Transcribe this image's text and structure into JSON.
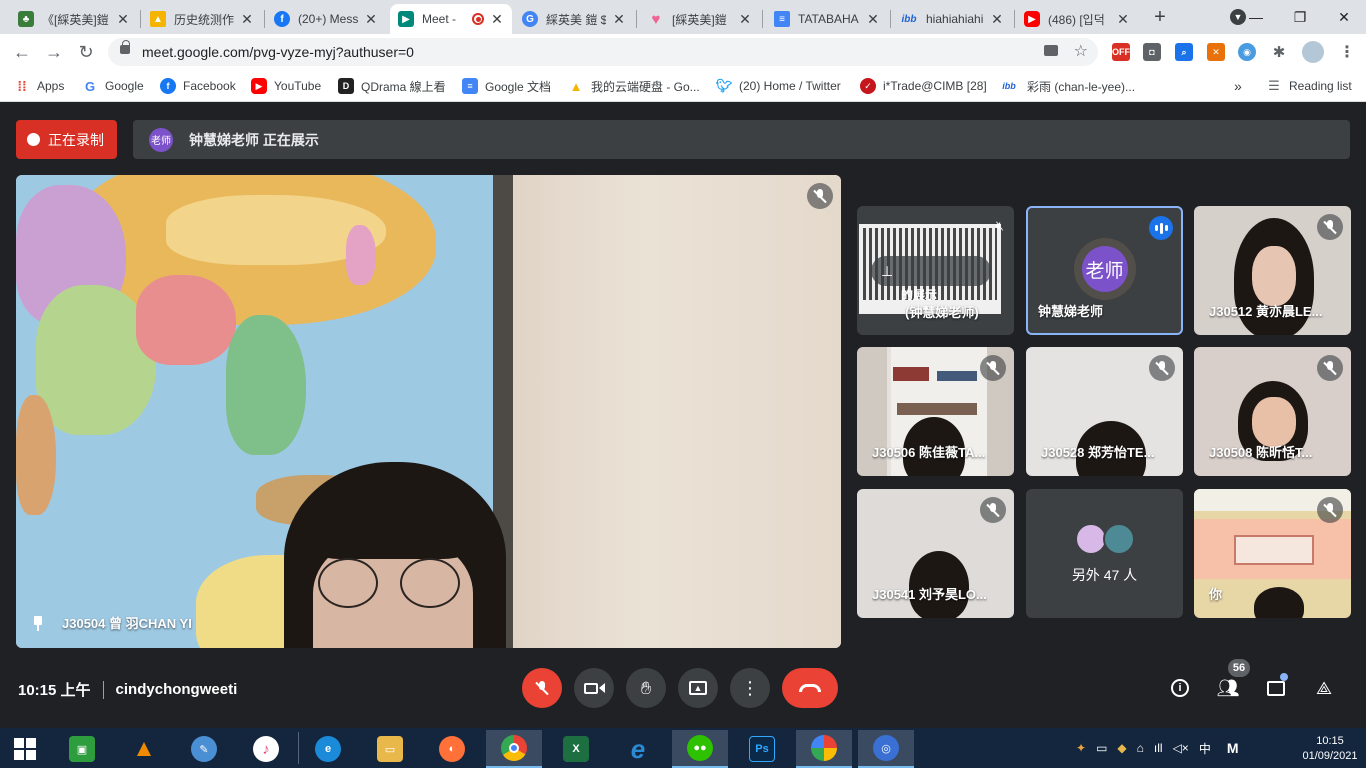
{
  "browser": {
    "tabs": [
      {
        "title": "《[綵英美]鎧",
        "favicon": "tree-icon",
        "color": "#3a7d3a",
        "active": false
      },
      {
        "title": "历史统测作",
        "favicon": "drive-icon",
        "color": "#f4b400",
        "active": false
      },
      {
        "title": "(20+) Mess",
        "favicon": "facebook-icon",
        "color": "#1877f2",
        "active": false
      },
      {
        "title": "Meet -",
        "favicon": "meet-icon",
        "color": "#00897b",
        "active": true
      },
      {
        "title": "綵英美 鎧 $",
        "favicon": "google-icon",
        "color": "#4285f4",
        "active": false
      },
      {
        "title": "[綵英美]鎧",
        "favicon": "heart-icon",
        "color": "#f06292",
        "active": false
      },
      {
        "title": "TATABAHA",
        "favicon": "docs-icon",
        "color": "#4285f4",
        "active": false
      },
      {
        "title": "hiahiahiahi",
        "favicon": "ibb-icon",
        "color": "#1e63d6",
        "active": false
      },
      {
        "title": "(486) [입덕",
        "favicon": "youtube-icon",
        "color": "#ff0000",
        "active": false
      }
    ],
    "url": "meet.google.com/pvg-vyze-myj?authuser=0",
    "bookmarks": [
      {
        "label": "Apps",
        "icon": "apps-grid-icon",
        "color": "#ea4335"
      },
      {
        "label": "Google",
        "icon": "google-icon",
        "color": "#4285f4"
      },
      {
        "label": "Facebook",
        "icon": "facebook-icon",
        "color": "#1877f2"
      },
      {
        "label": "YouTube",
        "icon": "youtube-icon",
        "color": "#ff0000"
      },
      {
        "label": "QDrama 線上看",
        "icon": "qdrama-icon",
        "color": "#222222"
      },
      {
        "label": "Google 文档",
        "icon": "docs-icon",
        "color": "#4285f4"
      },
      {
        "label": "我的云端硬盘 - Go...",
        "icon": "drive-icon",
        "color": "#f4b400"
      },
      {
        "label": "(20) Home / Twitter",
        "icon": "twitter-icon",
        "color": "#1da1f2"
      },
      {
        "label": "i*Trade@CIMB [28]",
        "icon": "cimb-icon",
        "color": "#c4161c"
      },
      {
        "label": "彩雨 (chan-le-yee)...",
        "icon": "ibb-icon",
        "color": "#1e63d6"
      }
    ],
    "reading_list": "Reading list"
  },
  "meet": {
    "recording_label": "正在录制",
    "presenting_avatar": "老师",
    "presenting_text": "钟慧娣老师 正在展示",
    "main_tile_name": "J30504 曾 羽CHAN YI",
    "tiles": [
      {
        "name": "(钟慧娣老师)",
        "caption": "的展示",
        "kind": "screen"
      },
      {
        "name": "钟慧娣老师",
        "avatar": "老师",
        "kind": "avatar",
        "speaking": true
      },
      {
        "name": "J30512 黄亦晨LE...",
        "kind": "video"
      },
      {
        "name": "J30506 陈佳薇TA...",
        "kind": "video"
      },
      {
        "name": "J30528 郑芳怡TE...",
        "kind": "video"
      },
      {
        "name": "J30508 陈昕恬T...",
        "kind": "video"
      },
      {
        "name": "J30541 刘予昊LO...",
        "kind": "video"
      },
      {
        "name": "另外 47 人",
        "kind": "others"
      },
      {
        "name": "你",
        "kind": "self"
      }
    ],
    "time": "10:15 上午",
    "meeting_user": "cindychongweeti",
    "participant_count": "56"
  },
  "taskbar": {
    "apps": [
      {
        "name": "store-icon",
        "color": "#2e9d3e"
      },
      {
        "name": "vlc-icon",
        "color": "#f08a00"
      },
      {
        "name": "paint-icon",
        "color": "#4a8fd4"
      },
      {
        "name": "itunes-icon",
        "color": "#e64b7c"
      },
      {
        "name": "edge-icon",
        "color": "#1b8ad8"
      },
      {
        "name": "explorer-icon",
        "color": "#e8b84a"
      },
      {
        "name": "firefox-icon",
        "color": "#ff7139"
      },
      {
        "name": "chrome-icon",
        "color": "#4285f4"
      },
      {
        "name": "excel-icon",
        "color": "#1d6f42"
      },
      {
        "name": "ie-icon",
        "color": "#2a8ad4"
      },
      {
        "name": "wechat-icon",
        "color": "#2dc100"
      },
      {
        "name": "photoshop-icon",
        "color": "#0b2a4a"
      },
      {
        "name": "photos-icon",
        "color": "#e8a33d"
      },
      {
        "name": "app-icon",
        "color": "#3a6fd4"
      }
    ],
    "ime": "中",
    "ime2": "M",
    "clock_time": "10:15",
    "clock_date": "01/09/2021"
  }
}
